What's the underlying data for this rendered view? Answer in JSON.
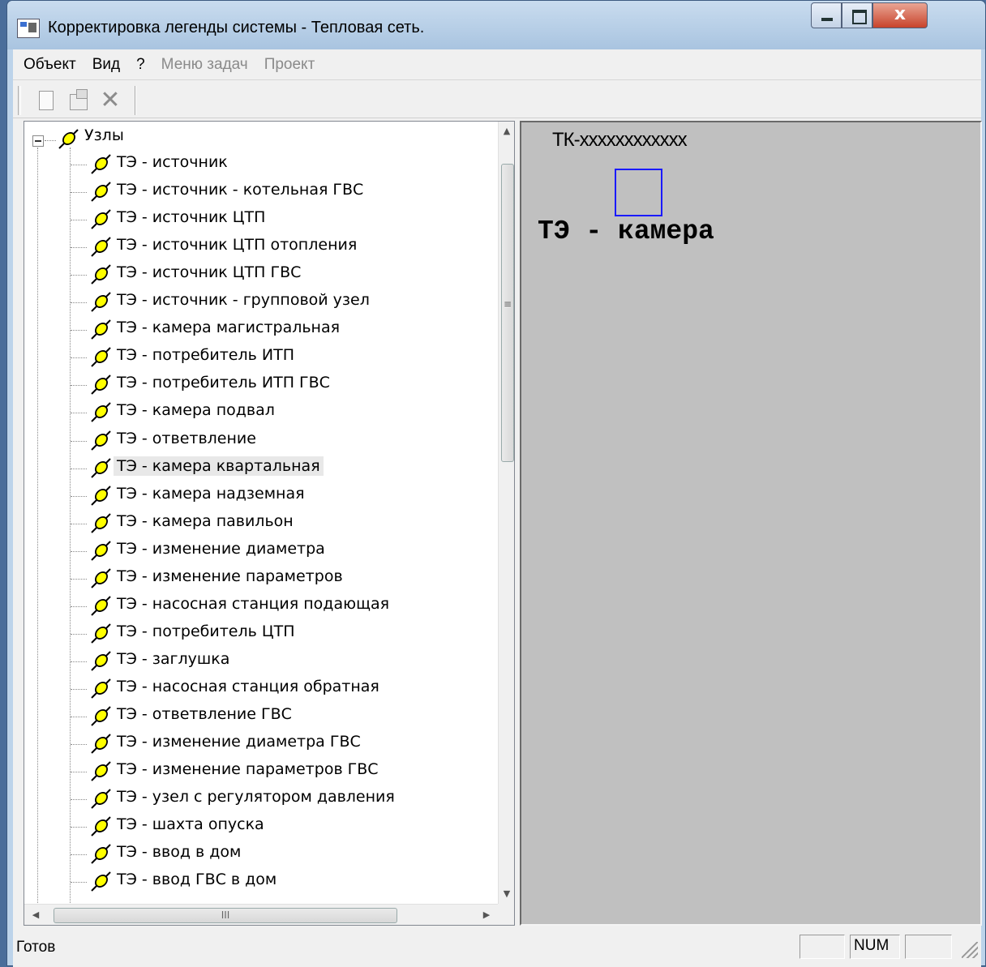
{
  "window": {
    "title": "Корректировка легенды системы - Тепловая сеть.",
    "close_label": "x"
  },
  "menubar": {
    "items": [
      {
        "label": "Объект",
        "enabled": true
      },
      {
        "label": "Вид",
        "enabled": true
      },
      {
        "label": "?",
        "enabled": true
      },
      {
        "label": "Меню задач",
        "enabled": false
      },
      {
        "label": "Проект",
        "enabled": false
      }
    ]
  },
  "toolbar": {
    "new_icon": "new-document-icon",
    "properties_icon": "properties-icon",
    "delete_glyph": "✕"
  },
  "tree": {
    "root_label": "Узлы",
    "node_icon": "node-pin-icon",
    "selected_index": 11,
    "items": [
      "ТЭ - источник",
      "ТЭ - источник - котельная ГВС",
      "ТЭ - источник ЦТП",
      "ТЭ - источник ЦТП отопления",
      "ТЭ - источник ЦТП ГВС",
      "ТЭ - источник - групповой узел",
      "ТЭ - камера магистральная",
      "ТЭ - потребитель ИТП",
      "ТЭ - потребитель ИТП ГВС",
      "ТЭ - камера подвал",
      "ТЭ - ответвление",
      "ТЭ - камера квартальная",
      "ТЭ - камера надземная",
      "ТЭ - камера павильон",
      "ТЭ - изменение диаметра",
      "ТЭ - изменение параметров",
      "ТЭ - насосная станция подающая",
      "ТЭ - потребитель ЦТП",
      "ТЭ - заглушка",
      "ТЭ - насосная станция обратная",
      "ТЭ - ответвление ГВС",
      "ТЭ - изменение диаметра ГВС",
      "ТЭ - изменение параметров ГВС",
      "ТЭ - узел с регулятором давления",
      "ТЭ - шахта опуска",
      "ТЭ - ввод в дом",
      "ТЭ - ввод ГВС в дом"
    ]
  },
  "scrollbars": {
    "up_arrow": "▲",
    "down_arrow": "▼",
    "left_arrow": "◀",
    "right_arrow": "▶",
    "vthumb_grip": "≡",
    "hthumb_grip": "III"
  },
  "preview": {
    "code": "ТК-xxxxxxxxxxxx",
    "name": "ТЭ - камера",
    "symbol_color": "#1a1aff",
    "background": "#c0c0c0"
  },
  "statusbar": {
    "text": "Готов",
    "panels": [
      "",
      "NUM",
      ""
    ]
  },
  "colors": {
    "node_icon_fill": "#ffff00",
    "node_icon_stroke": "#000000"
  }
}
